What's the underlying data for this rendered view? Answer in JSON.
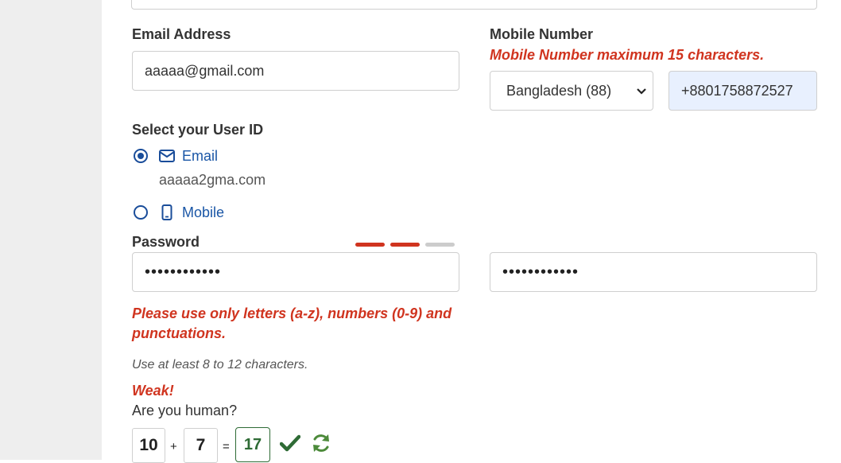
{
  "form": {
    "email_label": "Email Address",
    "email_value": "aaaaa@gmail.com",
    "mobile_label": "Mobile Number",
    "mobile_error": "Mobile Number maximum 15 characters.",
    "country_selected": "Bangladesh (88)",
    "mobile_value": "+8801758872527",
    "userid_label": "Select your User ID",
    "userid_options": [
      {
        "label": "Email",
        "icon": "envelope-icon",
        "selected": true
      },
      {
        "label": "Mobile",
        "icon": "mobile-phone-icon",
        "selected": false
      }
    ],
    "userid_email_value": "aaaaa2gma.com",
    "password_label": "Password",
    "password_strength_level": 2,
    "password_strength_max": 3,
    "password_value": "••••••••••••",
    "confirm_password_value": "••••••••••••",
    "password_error": "Please use only letters (a-z), numbers (0-9) and punctuations.",
    "password_hint": "Use at least 8 to 12 characters.",
    "strength_text": "Weak!",
    "captcha_label": "Are you human?",
    "captcha_a": "10",
    "captcha_op": "+",
    "captcha_b": "7",
    "captcha_eq": "=",
    "captcha_answer": "17"
  },
  "colors": {
    "error": "#d0341f",
    "link_blue": "#1a56a6",
    "strength_active": "#d0341f",
    "strength_inactive": "#cccccc",
    "success_green": "#2e6b35",
    "autofill_bg": "#e8f0fe"
  }
}
